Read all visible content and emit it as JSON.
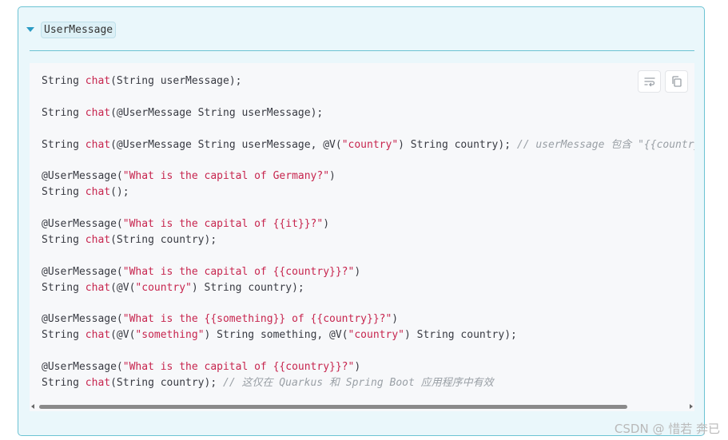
{
  "panel": {
    "tag": "UserMessage"
  },
  "code_lines": [
    [
      {
        "t": "String "
      },
      {
        "t": "chat",
        "c": "fn"
      },
      {
        "t": "(String userMessage);"
      }
    ],
    [],
    [
      {
        "t": "String "
      },
      {
        "t": "chat",
        "c": "fn"
      },
      {
        "t": "(@UserMessage String userMessage);"
      }
    ],
    [],
    [
      {
        "t": "String "
      },
      {
        "t": "chat",
        "c": "fn"
      },
      {
        "t": "(@UserMessage String userMessage, @V("
      },
      {
        "t": "\"country\"",
        "c": "str"
      },
      {
        "t": ") String country); "
      },
      {
        "t": "// userMessage 包含 \"{{country}}\"",
        "c": "cmt"
      }
    ],
    [],
    [
      {
        "t": "@UserMessage("
      },
      {
        "t": "\"What is the capital of Germany?\"",
        "c": "str"
      },
      {
        "t": ")"
      }
    ],
    [
      {
        "t": "String "
      },
      {
        "t": "chat",
        "c": "fn"
      },
      {
        "t": "();"
      }
    ],
    [],
    [
      {
        "t": "@UserMessage("
      },
      {
        "t": "\"What is the capital of {{it}}?\"",
        "c": "str"
      },
      {
        "t": ")"
      }
    ],
    [
      {
        "t": "String "
      },
      {
        "t": "chat",
        "c": "fn"
      },
      {
        "t": "(String country);"
      }
    ],
    [],
    [
      {
        "t": "@UserMessage("
      },
      {
        "t": "\"What is the capital of {{country}}?\"",
        "c": "str"
      },
      {
        "t": ")"
      }
    ],
    [
      {
        "t": "String "
      },
      {
        "t": "chat",
        "c": "fn"
      },
      {
        "t": "(@V("
      },
      {
        "t": "\"country\"",
        "c": "str"
      },
      {
        "t": ") String country);"
      }
    ],
    [],
    [
      {
        "t": "@UserMessage("
      },
      {
        "t": "\"What is the {{something}} of {{country}}?\"",
        "c": "str"
      },
      {
        "t": ")"
      }
    ],
    [
      {
        "t": "String "
      },
      {
        "t": "chat",
        "c": "fn"
      },
      {
        "t": "(@V("
      },
      {
        "t": "\"something\"",
        "c": "str"
      },
      {
        "t": ") String something, @V("
      },
      {
        "t": "\"country\"",
        "c": "str"
      },
      {
        "t": ") String country);"
      }
    ],
    [],
    [
      {
        "t": "@UserMessage("
      },
      {
        "t": "\"What is the capital of {{country}}?\"",
        "c": "str"
      },
      {
        "t": ")"
      }
    ],
    [
      {
        "t": "String "
      },
      {
        "t": "chat",
        "c": "fn"
      },
      {
        "t": "(String country); "
      },
      {
        "t": "// 这仅在 Quarkus 和 Spring Boot 应用程序中有效",
        "c": "cmt"
      }
    ]
  ],
  "toolbar": {
    "wrap_icon": "wrap-lines-icon",
    "copy_icon": "copy-icon"
  },
  "colors": {
    "accent": "#6cc3d3",
    "string": "#c7254e",
    "comment": "#9aa0a6"
  },
  "watermark": "CSDN @ 惜若 奔已"
}
